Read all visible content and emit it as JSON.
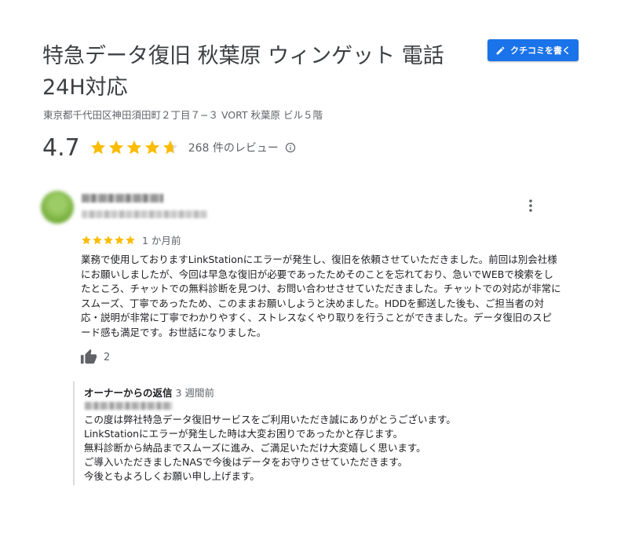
{
  "business": {
    "title": "特急データ復旧 秋葉原 ウィンゲット 電話24H対応",
    "address": "東京都千代田区神田須田町２丁目７−３ VORT 秋葉原 ビル５階",
    "rating": "4.7",
    "rating_value": 4.7,
    "review_count": "268 件のレビュー"
  },
  "write_review_button": {
    "label": "クチコミを書く",
    "icon": "pencil-icon"
  },
  "review": {
    "stars": 5,
    "time": "1 か月前",
    "text": "業務で使用しておりますLinkStationにエラーが発生し、復旧を依頼させていただきました。前回は別会社様にお願いしましたが、今回は早急な復旧が必要であったためそのことを忘れており、急いでWEBで検索をしたところ、チャットでの無料診断を見つけ、お問い合わせさせていただきました。チャットでの対応が非常にスムーズ、丁寧であったため、このままお願いしようと決めました。HDDを郵送した後も、ご担当者の対応・説明が非常に丁寧でわかりやすく、ストレスなくやり取りを行うことができました。データ復旧のスピード感も満足です。お世話になりました。",
    "likes": "2"
  },
  "owner_reply": {
    "label": "オーナーからの返信",
    "time": "3 週間前",
    "lines": [
      "この度は弊社特急データ復旧サービスをご利用いただき誠にありがとうございます。",
      "LinkStationにエラーが発生した時は大変お困りであったかと存じます。",
      "無料診断から納品までスムーズに進み、ご満足いただけ大変嬉しく思います。",
      "ご導入いただきましたNASで今後はデータをお守りさせていただきます。",
      "今後ともよろしくお願い申し上げます。"
    ]
  },
  "colors": {
    "star": "#fbbc04",
    "star_empty": "#dadce0",
    "button": "#1a73e8",
    "text_secondary": "#5f6368"
  }
}
